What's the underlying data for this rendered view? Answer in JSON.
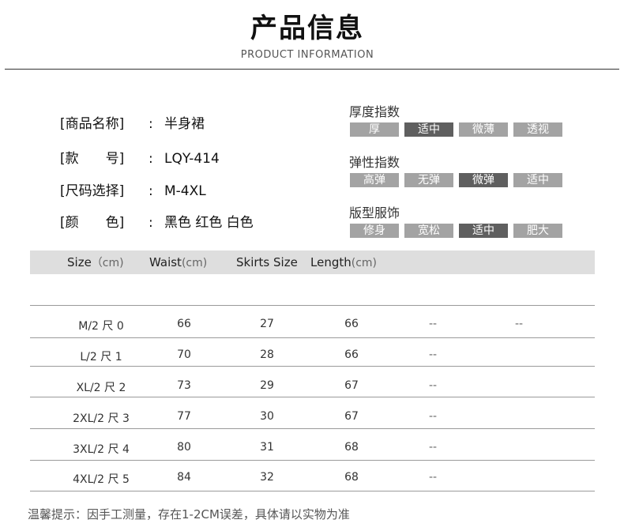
{
  "header": {
    "title": "产品信息",
    "subtitle": "PRODUCT  INFORMATION"
  },
  "info": [
    {
      "label": "[商品名称]",
      "sep": ":",
      "value": "半身裙"
    },
    {
      "label": "[款　　号]",
      "sep": ":",
      "value": "LQY-414"
    },
    {
      "label": "[尺码选择]",
      "sep": ":",
      "value": "M-4XL"
    },
    {
      "label": "[颜　　色]",
      "sep": ":",
      "value": "黑色  红色  白色"
    }
  ],
  "indices": [
    {
      "title": "厚度指数",
      "options": [
        "厚",
        "适中",
        "微薄",
        "透视"
      ],
      "active": 1
    },
    {
      "title": "弹性指数",
      "options": [
        "高弹",
        "无弹",
        "微弹",
        "适中"
      ],
      "active": 2
    },
    {
      "title": "版型服饰",
      "options": [
        "修身",
        "宽松",
        "适中",
        "肥大"
      ],
      "active": 2
    }
  ],
  "table": {
    "headers": [
      {
        "name": "Size",
        "unit": "（cm)"
      },
      {
        "name": "Waist",
        "unit": "(cm)"
      },
      {
        "name": "Skirts Size",
        "unit": ""
      },
      {
        "name": "Length",
        "unit": "(cm)"
      }
    ],
    "rows": [
      {
        "size": "M/2 尺 0",
        "waist": "66",
        "skirts": "27",
        "length": "66",
        "c5": "--",
        "c6": "--"
      },
      {
        "size": "L/2 尺 1",
        "waist": "70",
        "skirts": "28",
        "length": "66",
        "c5": "--",
        "c6": ""
      },
      {
        "size": "XL/2 尺 2",
        "waist": "73",
        "skirts": "29",
        "length": "67",
        "c5": "--",
        "c6": ""
      },
      {
        "size": "2XL/2 尺 3",
        "waist": "77",
        "skirts": "30",
        "length": "67",
        "c5": "--",
        "c6": ""
      },
      {
        "size": "3XL/2 尺 4",
        "waist": "80",
        "skirts": "31",
        "length": "68",
        "c5": "--",
        "c6": ""
      },
      {
        "size": "4XL/2 尺 5",
        "waist": "84",
        "skirts": "32",
        "length": "68",
        "c5": "--",
        "c6": ""
      }
    ]
  },
  "footer": {
    "note": "温馨提示：因手工测量，存在1-2CM误差，具体请以实物为准"
  },
  "colors": {
    "pill_inactive": "#a3a3a3",
    "pill_active": "#5f5f5f",
    "table_header_bg": "#dedede"
  }
}
